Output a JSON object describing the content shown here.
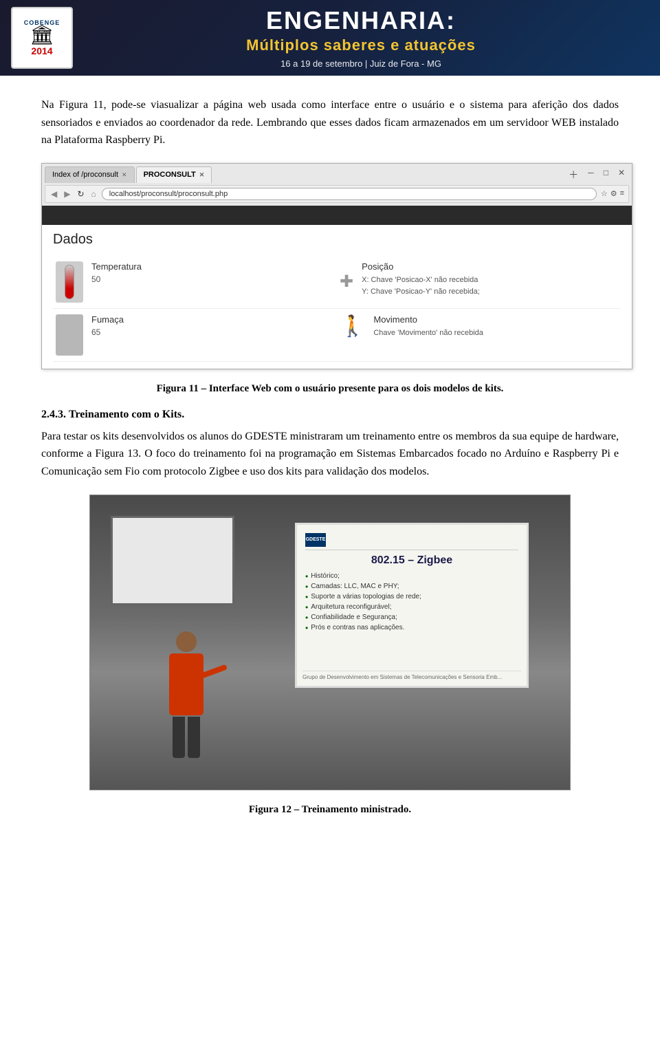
{
  "header": {
    "logo_text": "COBENGE",
    "logo_building": "🏛",
    "logo_year": "2014",
    "main_title": "ENGENHARIA:",
    "sub_title": "Múltiplos saberes e atuações",
    "date_text": "16 a 19 de setembro | Juiz de Fora - MG"
  },
  "intro_paragraph": "Na Figura 11, pode-se viasualizar a página web usada como interface entre o usuário e o sistema para aferição dos dados sensoriados e enviados ao coordenador da rede. Lembrando que esses dados ficam armazenados em um servidoor WEB instalado na Plataforma Raspberry Pi.",
  "browser": {
    "tab1": "Index of /proconsult",
    "tab2": "PROCONSULT",
    "address": "localhost/proconsult/proconsult.php",
    "page_title": "Dados",
    "temperatura_label": "Temperatura",
    "temperatura_value": "50",
    "posicao_label": "Posição",
    "posicao_x": "X: Chave 'Posicao-X' não recebida",
    "posicao_y": "Y: Chave 'Posicao-Y' não recebida;",
    "fumaca_label": "Fumaça",
    "fumaca_value": "65",
    "movimento_label": "Movimento",
    "movimento_value": "Chave 'Movimento' não recebida"
  },
  "figure11_caption": "Figura 11 – Interface Web com o usuário presente para os dois modelos de kits.",
  "section_number": "2.4.3.",
  "section_title": "Treinamento com o Kits.",
  "section_paragraph1": "Para testar os kits desenvolvidos os alunos do GDESTE ministraram um treinamento entre os membros da sua equipe de hardware, conforme a Figura 13. O foco do treinamento foi na programação em Sistemas Embarcados focado no Arduíno e Raspberry Pi e Comunicação sem Fio com protocolo Zigbee e uso dos kits para validação dos modelos.",
  "screen": {
    "logo_text": "GDESTE",
    "title": "802.15 – Zigbee",
    "bullets": [
      "Histórico;",
      "Camadas: LLC, MAC e PHY;",
      "Suporte a várias topologias de rede;",
      "Arquitetura reconfigurável;",
      "Confiabilidade e Segurança;",
      "Prós e contras nas aplicações."
    ],
    "footer": "Grupo de Desenvolvimento em Sistemas de Telecomunicações e Sensoria Emb..."
  },
  "figure12_caption": "Figura 12 – Treinamento ministrado."
}
